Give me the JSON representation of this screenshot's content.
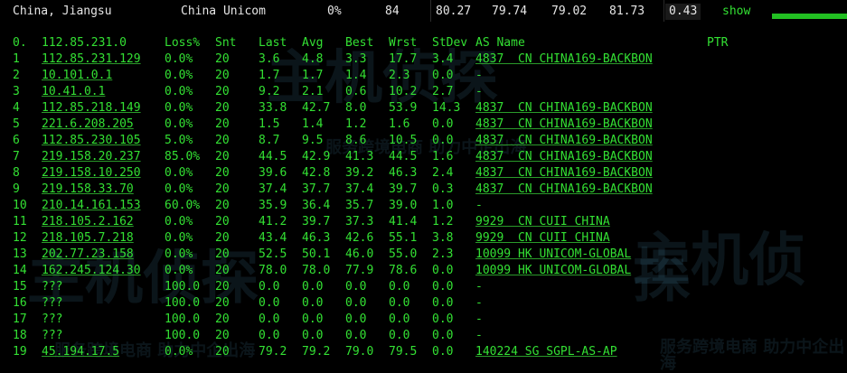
{
  "summary": {
    "location": "China, Jiangsu",
    "isp": "China Unicom",
    "loss": "0%",
    "sent": "84",
    "last": "80.27",
    "avg": "79.74",
    "best": "79.02",
    "worst": "81.73",
    "stdev": "0.43",
    "action": "show"
  },
  "header": [
    "0.",
    "112.85.231.0",
    "Loss%",
    "Snt",
    "Last",
    "Avg",
    "Best",
    "Wrst",
    "StDev",
    "AS Name",
    "PTR"
  ],
  "rows": [
    [
      "1",
      "112.85.231.129",
      "0.0%",
      "20",
      "3.6",
      "4.8",
      "3.3",
      "17.7",
      "3.4",
      "4837  CN CHINA169-BACKBON"
    ],
    [
      "2",
      "10.101.0.1",
      "0.0%",
      "20",
      "1.7",
      "1.7",
      "1.4",
      "2.3",
      "0.0",
      "-"
    ],
    [
      "3",
      "10.41.0.1",
      "0.0%",
      "20",
      "9.2",
      "2.1",
      "0.6",
      "10.2",
      "2.7",
      "-"
    ],
    [
      "4",
      "112.85.218.149",
      "0.0%",
      "20",
      "33.8",
      "42.7",
      "8.0",
      "53.9",
      "14.3",
      "4837  CN CHINA169-BACKBON"
    ],
    [
      "5",
      "221.6.208.205",
      "0.0%",
      "20",
      "1.5",
      "1.4",
      "1.2",
      "1.6",
      "0.0",
      "4837  CN CHINA169-BACKBON"
    ],
    [
      "6",
      "112.85.230.105",
      "5.0%",
      "20",
      "8.7",
      "9.5",
      "8.6",
      "10.5",
      "0.0",
      "4837  CN CHINA169-BACKBON"
    ],
    [
      "7",
      "219.158.20.237",
      "85.0%",
      "20",
      "44.5",
      "42.9",
      "41.3",
      "44.5",
      "1.6",
      "4837  CN CHINA169-BACKBON"
    ],
    [
      "8",
      "219.158.10.250",
      "0.0%",
      "20",
      "39.6",
      "42.8",
      "39.2",
      "46.3",
      "2.4",
      "4837  CN CHINA169-BACKBON"
    ],
    [
      "9",
      "219.158.33.70",
      "0.0%",
      "20",
      "37.4",
      "37.7",
      "37.4",
      "39.7",
      "0.3",
      "4837  CN CHINA169-BACKBON"
    ],
    [
      "10",
      "210.14.161.153",
      "60.0%",
      "20",
      "35.9",
      "36.4",
      "35.7",
      "39.0",
      "1.0",
      "-"
    ],
    [
      "11",
      "218.105.2.162",
      "0.0%",
      "20",
      "41.2",
      "39.7",
      "37.3",
      "41.4",
      "1.2",
      "9929  CN CUII CHINA"
    ],
    [
      "12",
      "218.105.7.218",
      "0.0%",
      "20",
      "43.4",
      "46.3",
      "42.6",
      "55.1",
      "3.8",
      "9929  CN CUII CHINA"
    ],
    [
      "13",
      "202.77.23.158",
      "0.0%",
      "20",
      "52.5",
      "50.1",
      "46.0",
      "55.0",
      "2.3",
      "10099 HK UNICOM-GLOBAL"
    ],
    [
      "14",
      "162.245.124.30",
      "0.0%",
      "20",
      "78.0",
      "78.0",
      "77.9",
      "78.6",
      "0.0",
      "10099 HK UNICOM-GLOBAL"
    ],
    [
      "15",
      "???",
      "100.0",
      "20",
      "0.0",
      "0.0",
      "0.0",
      "0.0",
      "0.0",
      "-"
    ],
    [
      "16",
      "???",
      "100.0",
      "20",
      "0.0",
      "0.0",
      "0.0",
      "0.0",
      "0.0",
      "-"
    ],
    [
      "17",
      "???",
      "100.0",
      "20",
      "0.0",
      "0.0",
      "0.0",
      "0.0",
      "0.0",
      "-"
    ],
    [
      "18",
      "???",
      "100.0",
      "20",
      "0.0",
      "0.0",
      "0.0",
      "0.0",
      "0.0",
      "-"
    ],
    [
      "19",
      "45.194.17.5",
      "0.0%",
      "20",
      "79.2",
      "79.2",
      "79.0",
      "79.5",
      "0.0",
      "140224 SG SGPL-AS-AP"
    ]
  ],
  "watermark": {
    "brand": "主机侦探",
    "slogan": "服务跨境电商 助力中企出海"
  }
}
